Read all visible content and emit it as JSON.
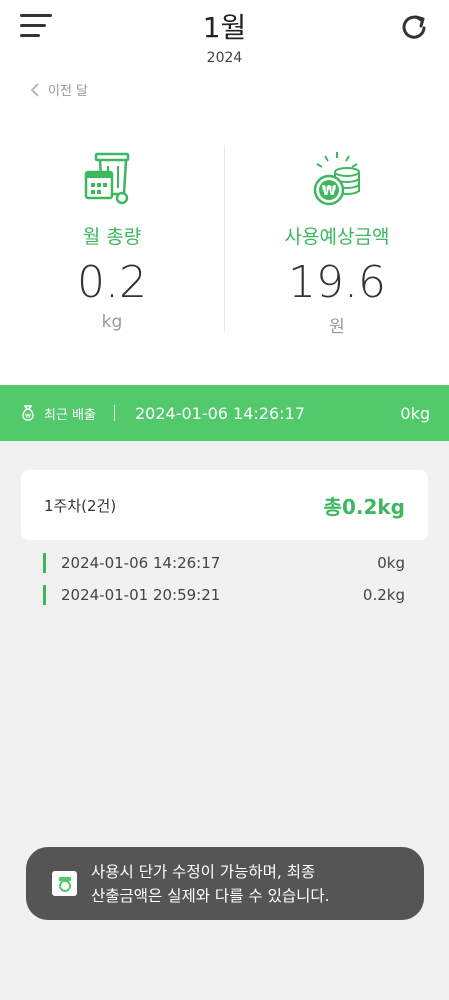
{
  "header": {
    "month": "1월",
    "year": "2024",
    "prev_label": "이전 달"
  },
  "stats": {
    "total": {
      "label": "월 총량",
      "value": "0.2",
      "unit": "kg"
    },
    "cost": {
      "label": "사용예상금액",
      "value": "19.6",
      "unit": "원"
    }
  },
  "recent": {
    "label": "최근 배출",
    "datetime": "2024-01-06 14:26:17",
    "value": "0kg"
  },
  "week": {
    "label": "1주차(2건)",
    "total": "총0.2kg",
    "entries": [
      {
        "datetime": "2024-01-06 14:26:17",
        "value": "0kg"
      },
      {
        "datetime": "2024-01-01 20:59:21",
        "value": "0.2kg"
      }
    ]
  },
  "toast": {
    "line1": "사용시 단가 수정이 가능하며, 최종",
    "line2": "산출금액은 실제와 다를 수 있습니다."
  },
  "colors": {
    "accent": "#3db85f",
    "bar": "#52c96b",
    "toast_bg": "#555555"
  },
  "icons": [
    "menu-icon",
    "refresh-icon",
    "chevron-left-icon",
    "calendar-bin-icon",
    "coins-icon",
    "money-bag-icon",
    "app-icon"
  ]
}
